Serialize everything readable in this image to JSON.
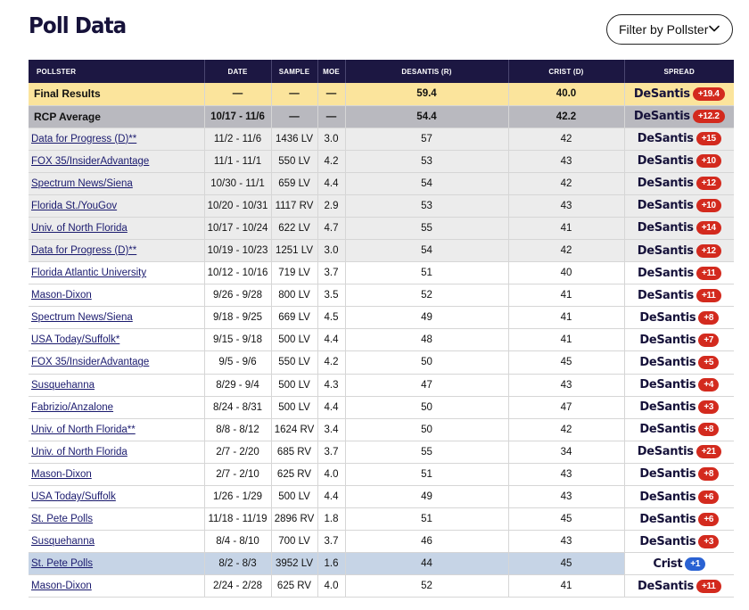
{
  "page": {
    "title": "Poll Data",
    "filter_label": "Filter by Pollster"
  },
  "colors": {
    "header_bg": "#1c1742",
    "final_bg": "#fbe49c",
    "rcp_bg": "#b9b9bf",
    "rep_badge": "#d32a1e",
    "dem_badge": "#2a62d3"
  },
  "table": {
    "headers": [
      "POLLSTER",
      "DATE",
      "SAMPLE",
      "MOE",
      "DESANTIS (R)",
      "CRIST (D)",
      "SPREAD"
    ],
    "rows": [
      {
        "kind": "final",
        "pollster": "Final Results",
        "date": "—",
        "sample": "—",
        "moe": "—",
        "desantis": "59.4",
        "crist": "40.0",
        "spread_name": "DeSantis",
        "spread_value": "+19.4",
        "party": "rep"
      },
      {
        "kind": "rcp",
        "pollster": "RCP Average",
        "date": "10/17 - 11/6",
        "sample": "—",
        "moe": "—",
        "desantis": "54.4",
        "crist": "42.2",
        "spread_name": "DeSantis",
        "spread_value": "+12.2",
        "party": "rep"
      },
      {
        "kind": "shaded",
        "pollster": "Data for Progress (D)**",
        "date": "11/2 - 11/6",
        "sample": "1436 LV",
        "moe": "3.0",
        "desantis": "57",
        "crist": "42",
        "spread_name": "DeSantis",
        "spread_value": "+15",
        "party": "rep"
      },
      {
        "kind": "shaded",
        "pollster": "FOX 35/InsiderAdvantage",
        "date": "11/1 - 11/1",
        "sample": "550 LV",
        "moe": "4.2",
        "desantis": "53",
        "crist": "43",
        "spread_name": "DeSantis",
        "spread_value": "+10",
        "party": "rep"
      },
      {
        "kind": "shaded",
        "pollster": "Spectrum News/Siena",
        "date": "10/30 - 11/1",
        "sample": "659 LV",
        "moe": "4.4",
        "desantis": "54",
        "crist": "42",
        "spread_name": "DeSantis",
        "spread_value": "+12",
        "party": "rep"
      },
      {
        "kind": "shaded",
        "pollster": "Florida St./YouGov",
        "date": "10/20 - 10/31",
        "sample": "1117 RV",
        "moe": "2.9",
        "desantis": "53",
        "crist": "43",
        "spread_name": "DeSantis",
        "spread_value": "+10",
        "party": "rep"
      },
      {
        "kind": "shaded",
        "pollster": "Univ. of North Florida",
        "date": "10/17 - 10/24",
        "sample": "622 LV",
        "moe": "4.7",
        "desantis": "55",
        "crist": "41",
        "spread_name": "DeSantis",
        "spread_value": "+14",
        "party": "rep"
      },
      {
        "kind": "shaded",
        "pollster": "Data for Progress (D)**",
        "date": "10/19 - 10/23",
        "sample": "1251 LV",
        "moe": "3.0",
        "desantis": "54",
        "crist": "42",
        "spread_name": "DeSantis",
        "spread_value": "+12",
        "party": "rep"
      },
      {
        "kind": "plain",
        "pollster": "Florida Atlantic University",
        "date": "10/12 - 10/16",
        "sample": "719 LV",
        "moe": "3.7",
        "desantis": "51",
        "crist": "40",
        "spread_name": "DeSantis",
        "spread_value": "+11",
        "party": "rep"
      },
      {
        "kind": "plain",
        "pollster": "Mason-Dixon",
        "date": "9/26 - 9/28",
        "sample": "800 LV",
        "moe": "3.5",
        "desantis": "52",
        "crist": "41",
        "spread_name": "DeSantis",
        "spread_value": "+11",
        "party": "rep"
      },
      {
        "kind": "plain",
        "pollster": "Spectrum News/Siena",
        "date": "9/18 - 9/25",
        "sample": "669 LV",
        "moe": "4.5",
        "desantis": "49",
        "crist": "41",
        "spread_name": "DeSantis",
        "spread_value": "+8",
        "party": "rep"
      },
      {
        "kind": "plain",
        "pollster": "USA Today/Suffolk*",
        "date": "9/15 - 9/18",
        "sample": "500 LV",
        "moe": "4.4",
        "desantis": "48",
        "crist": "41",
        "spread_name": "DeSantis",
        "spread_value": "+7",
        "party": "rep"
      },
      {
        "kind": "plain",
        "pollster": "FOX 35/InsiderAdvantage",
        "date": "9/5 - 9/6",
        "sample": "550 LV",
        "moe": "4.2",
        "desantis": "50",
        "crist": "45",
        "spread_name": "DeSantis",
        "spread_value": "+5",
        "party": "rep"
      },
      {
        "kind": "plain",
        "pollster": "Susquehanna",
        "date": "8/29 - 9/4",
        "sample": "500 LV",
        "moe": "4.3",
        "desantis": "47",
        "crist": "43",
        "spread_name": "DeSantis",
        "spread_value": "+4",
        "party": "rep"
      },
      {
        "kind": "plain",
        "pollster": "Fabrizio/Anzalone",
        "date": "8/24 - 8/31",
        "sample": "500 LV",
        "moe": "4.4",
        "desantis": "50",
        "crist": "47",
        "spread_name": "DeSantis",
        "spread_value": "+3",
        "party": "rep"
      },
      {
        "kind": "plain",
        "pollster": "Univ. of North Florida**",
        "date": "8/8 - 8/12",
        "sample": "1624 RV",
        "moe": "3.4",
        "desantis": "50",
        "crist": "42",
        "spread_name": "DeSantis",
        "spread_value": "+8",
        "party": "rep"
      },
      {
        "kind": "plain",
        "pollster": "Univ. of North Florida",
        "date": "2/7 - 2/20",
        "sample": "685 RV",
        "moe": "3.7",
        "desantis": "55",
        "crist": "34",
        "spread_name": "DeSantis",
        "spread_value": "+21",
        "party": "rep"
      },
      {
        "kind": "plain",
        "pollster": "Mason-Dixon",
        "date": "2/7 - 2/10",
        "sample": "625 RV",
        "moe": "4.0",
        "desantis": "51",
        "crist": "43",
        "spread_name": "DeSantis",
        "spread_value": "+8",
        "party": "rep"
      },
      {
        "kind": "plain",
        "pollster": "USA Today/Suffolk",
        "date": "1/26 - 1/29",
        "sample": "500 LV",
        "moe": "4.4",
        "desantis": "49",
        "crist": "43",
        "spread_name": "DeSantis",
        "spread_value": "+6",
        "party": "rep"
      },
      {
        "kind": "plain",
        "pollster": "St. Pete Polls",
        "date": "11/18 - 11/19",
        "sample": "2896 RV",
        "moe": "1.8",
        "desantis": "51",
        "crist": "45",
        "spread_name": "DeSantis",
        "spread_value": "+6",
        "party": "rep"
      },
      {
        "kind": "plain",
        "pollster": "Susquehanna",
        "date": "8/4 - 8/10",
        "sample": "700 LV",
        "moe": "3.7",
        "desantis": "46",
        "crist": "43",
        "spread_name": "DeSantis",
        "spread_value": "+3",
        "party": "rep"
      },
      {
        "kind": "hl",
        "pollster": "St. Pete Polls",
        "date": "8/2 - 8/3",
        "sample": "3952 LV",
        "moe": "1.6",
        "desantis": "44",
        "crist": "45",
        "spread_name": "Crist",
        "spread_value": "+1",
        "party": "dem"
      },
      {
        "kind": "plain",
        "pollster": "Mason-Dixon",
        "date": "2/24 - 2/28",
        "sample": "625 RV",
        "moe": "4.0",
        "desantis": "52",
        "crist": "41",
        "spread_name": "DeSantis",
        "spread_value": "+11",
        "party": "rep"
      }
    ]
  }
}
